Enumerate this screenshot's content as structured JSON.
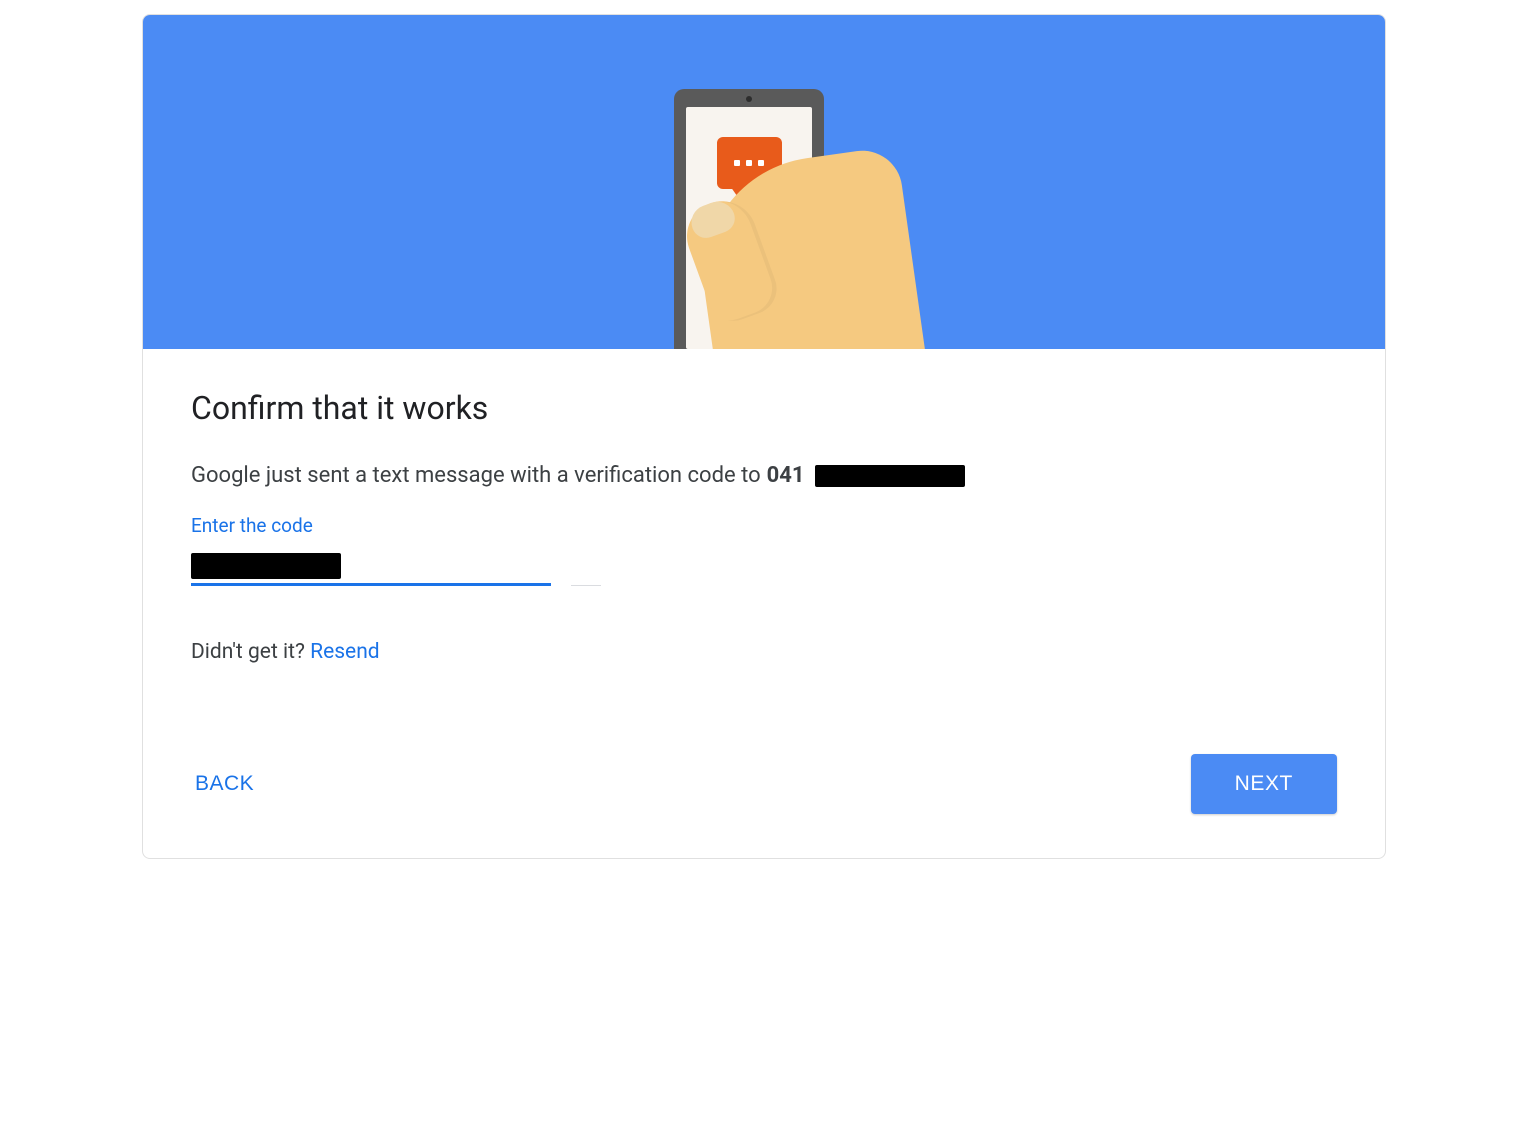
{
  "hero": {
    "illustration": "phone-in-hand-sms-icon"
  },
  "title": "Confirm that it works",
  "description_prefix": "Google just sent a text message with a verification code to",
  "phone_visible_prefix": "041",
  "field": {
    "label": "Enter the code",
    "value_redacted": true
  },
  "resend": {
    "prompt": "Didn't get it?",
    "link": "Resend"
  },
  "actions": {
    "back": "BACK",
    "next": "NEXT"
  }
}
